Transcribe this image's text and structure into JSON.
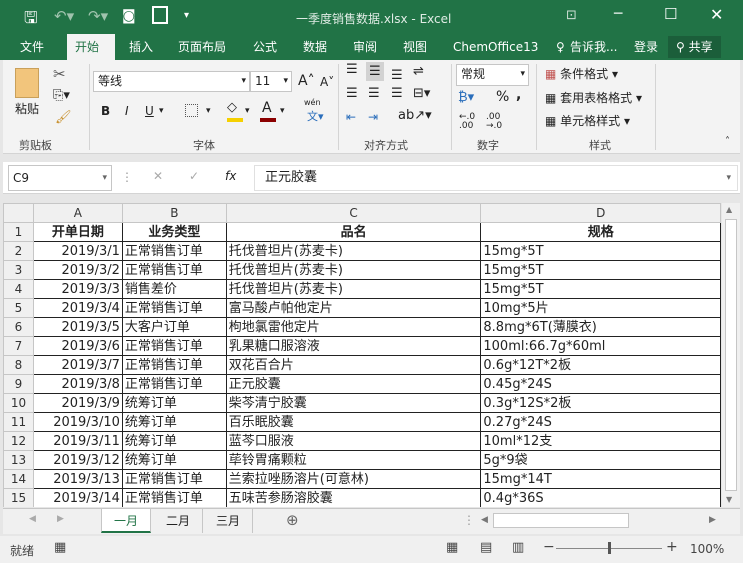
{
  "window": {
    "title": "一季度销售数据.xlsx - Excel"
  },
  "tabs": [
    "文件",
    "开始",
    "插入",
    "页面布局",
    "公式",
    "数据",
    "审阅",
    "视图",
    "ChemOffice13"
  ],
  "tell_me": "告诉我...",
  "login": "登录",
  "share": "共享",
  "ribbon": {
    "clipboard": {
      "label": "剪贴板",
      "paste": "粘贴"
    },
    "font": {
      "label": "字体",
      "font_name": "等线",
      "font_size": "11",
      "bold": "B",
      "italic": "I",
      "underline": "U",
      "wen": "wén",
      "fill_color": "#f5d000",
      "font_color": "#8b0000"
    },
    "alignment": {
      "label": "对齐方式"
    },
    "number": {
      "label": "数字",
      "format": "常规",
      "percent": "%",
      "comma": ","
    },
    "styles": {
      "label": "样式",
      "conditional": "条件格式",
      "table_format": "套用表格格式",
      "cell_styles": "单元格样式"
    }
  },
  "formula_bar": {
    "name_box": "C9",
    "fx": "fx",
    "value": "正元胶囊"
  },
  "columns": [
    "A",
    "B",
    "C",
    "D"
  ],
  "header": [
    "开单日期",
    "业务类型",
    "品名",
    "规格"
  ],
  "rows": [
    [
      "2019/3/1",
      "正常销售订单",
      "托伐普坦片(苏麦卡)",
      "15mg*5T"
    ],
    [
      "2019/3/2",
      "正常销售订单",
      "托伐普坦片(苏麦卡)",
      "15mg*5T"
    ],
    [
      "2019/3/3",
      "销售差价",
      "托伐普坦片(苏麦卡)",
      "15mg*5T"
    ],
    [
      "2019/3/4",
      "正常销售订单",
      "富马酸卢帕他定片",
      "10mg*5片"
    ],
    [
      "2019/3/5",
      "大客户订单",
      "枸地氯雷他定片",
      "8.8mg*6T(薄膜衣)"
    ],
    [
      "2019/3/6",
      "正常销售订单",
      "乳果糖口服溶液",
      "100ml:66.7g*60ml"
    ],
    [
      "2019/3/7",
      "正常销售订单",
      "双花百合片",
      "0.6g*12T*2板"
    ],
    [
      "2019/3/8",
      "正常销售订单",
      "正元胶囊",
      "0.45g*24S"
    ],
    [
      "2019/3/9",
      "统筹订单",
      "柴芩清宁胶囊",
      "0.3g*12S*2板"
    ],
    [
      "2019/3/10",
      "统筹订单",
      "百乐眠胶囊",
      "0.27g*24S"
    ],
    [
      "2019/3/11",
      "统筹订单",
      "蓝芩口服液",
      "10ml*12支"
    ],
    [
      "2019/3/12",
      "统筹订单",
      "荜铃胃痛颗粒",
      "5g*9袋"
    ],
    [
      "2019/3/13",
      "正常销售订单",
      "兰索拉唑肠溶片(可意林)",
      "15mg*14T"
    ],
    [
      "2019/3/14",
      "正常销售订单",
      "五味苦参肠溶胶囊",
      "0.4g*36S"
    ]
  ],
  "sheets": [
    "一月",
    "二月",
    "三月"
  ],
  "status": {
    "ready": "就绪",
    "zoom": "100%"
  }
}
